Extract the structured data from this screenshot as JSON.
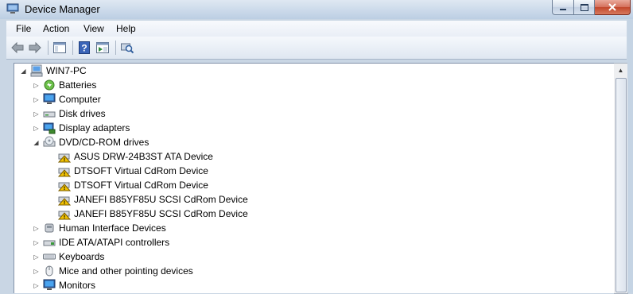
{
  "window": {
    "title": "Device Manager"
  },
  "menu": [
    "File",
    "Action",
    "View",
    "Help"
  ],
  "toolbar": {
    "icons": [
      "back-arrow-icon",
      "forward-arrow-icon",
      "show-hide-console-tree-icon",
      "help-icon",
      "properties-icon",
      "scan-hardware-icon"
    ]
  },
  "tree": {
    "root": "WIN7-PC",
    "categories": [
      {
        "label": "Batteries",
        "icon": "battery-icon",
        "expanded": false
      },
      {
        "label": "Computer",
        "icon": "computer-icon",
        "expanded": false
      },
      {
        "label": "Disk drives",
        "icon": "disk-drive-icon",
        "expanded": false
      },
      {
        "label": "Display adapters",
        "icon": "display-adapter-icon",
        "expanded": false
      },
      {
        "label": "DVD/CD-ROM drives",
        "icon": "dvd-drive-icon",
        "expanded": true,
        "children": [
          {
            "label": "ASUS DRW-24B3ST ATA Device",
            "icon": "dvd-warning-icon"
          },
          {
            "label": "DTSOFT Virtual CdRom Device",
            "icon": "dvd-warning-icon"
          },
          {
            "label": "DTSOFT Virtual CdRom Device",
            "icon": "dvd-warning-icon"
          },
          {
            "label": "JANEFI B85YF85U SCSI CdRom Device",
            "icon": "dvd-warning-icon"
          },
          {
            "label": "JANEFI B85YF85U SCSI CdRom Device",
            "icon": "dvd-warning-icon"
          }
        ]
      },
      {
        "label": "Human Interface Devices",
        "icon": "hid-icon",
        "expanded": false
      },
      {
        "label": "IDE ATA/ATAPI controllers",
        "icon": "ide-controller-icon",
        "expanded": false
      },
      {
        "label": "Keyboards",
        "icon": "keyboard-icon",
        "expanded": false
      },
      {
        "label": "Mice and other pointing devices",
        "icon": "mouse-icon",
        "expanded": false
      },
      {
        "label": "Monitors",
        "icon": "monitor-icon",
        "expanded": false
      }
    ]
  },
  "colors": {
    "titlebar": "#cddbeb",
    "menubar": "#eef2f8",
    "warning": "#f2c200",
    "selection": "#3399ff"
  }
}
